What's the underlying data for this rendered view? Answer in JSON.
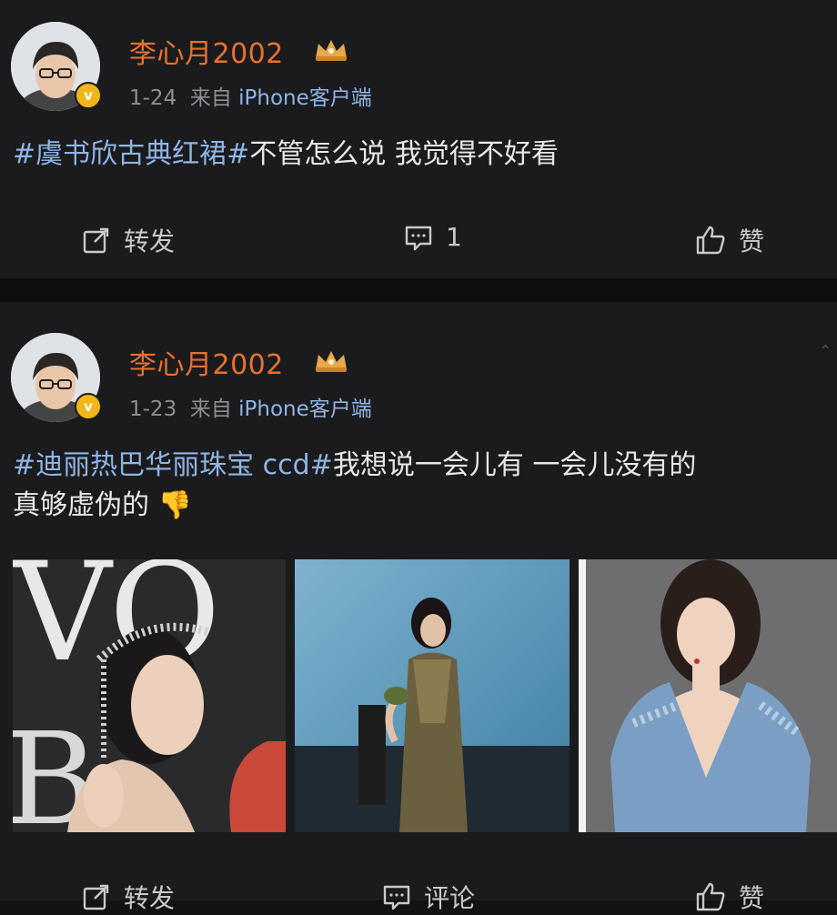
{
  "posts": [
    {
      "username": "李心月2002",
      "date": "1-24",
      "source_prefix": "来自",
      "source_device": "iPhone客户端",
      "hashtag": "#虞书欣古典红裙#",
      "text": "不管怎么说 我觉得不好看",
      "actions": {
        "repost": "转发",
        "comment_count": "1",
        "like": "赞"
      }
    },
    {
      "username": "李心月2002",
      "date": "1-23",
      "source_prefix": "来自",
      "source_device": "iPhone客户端",
      "hashtag": "#迪丽热巴华丽珠宝 ccd#",
      "text_line1": "我想说一会儿有 一会儿没有的",
      "text_line2": "真够虚伪的",
      "emoji": "👎",
      "actions": {
        "repost": "转发",
        "comment": "评论",
        "like": "赞"
      }
    }
  ],
  "colors": {
    "username": "#e8712d",
    "hashtag": "#8fb4e6",
    "meta": "#8e8e93",
    "background": "#1b1b1d"
  },
  "icons": [
    "crown-icon",
    "verified-badge-icon",
    "repost-icon",
    "comment-icon",
    "like-icon",
    "thumbs-down-emoji"
  ]
}
